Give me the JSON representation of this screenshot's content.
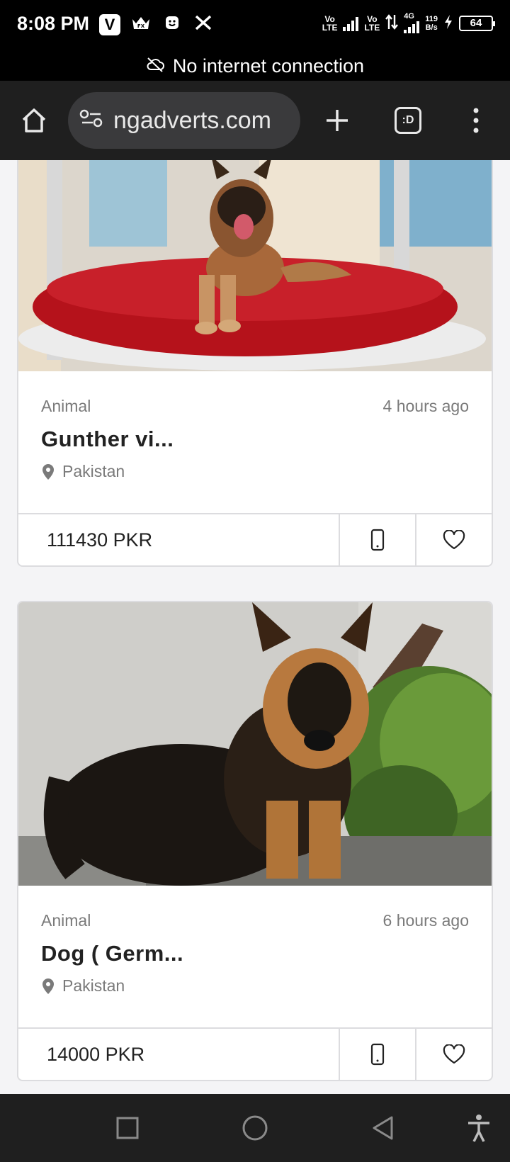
{
  "status_bar": {
    "time": "8:08 PM",
    "notifications": [
      "v-app-icon",
      "crown-fx-icon",
      "smiley-app-icon",
      "x-app-icon"
    ],
    "net1": "Vo\nLTE",
    "net2": "Vo\nLTE",
    "net_type": "4G",
    "speed_value": "119",
    "speed_unit": "B/s",
    "battery": "64"
  },
  "offline_banner": {
    "text": "No internet connection"
  },
  "browser": {
    "url": "ngadverts.com",
    "tab_badge": ":D"
  },
  "listings": [
    {
      "category": "Animal",
      "time": "4 hours ago",
      "title": "Gunther vi...",
      "location": "Pakistan",
      "price": "111430 PKR"
    },
    {
      "category": "Animal",
      "time": "6 hours ago",
      "title": "Dog ( Germ...",
      "location": "Pakistan",
      "price": "14000 PKR"
    }
  ],
  "colors": {
    "bed_red": "#b5121b",
    "dog_tan": "#a8683a",
    "accent_dark": "#222222"
  }
}
